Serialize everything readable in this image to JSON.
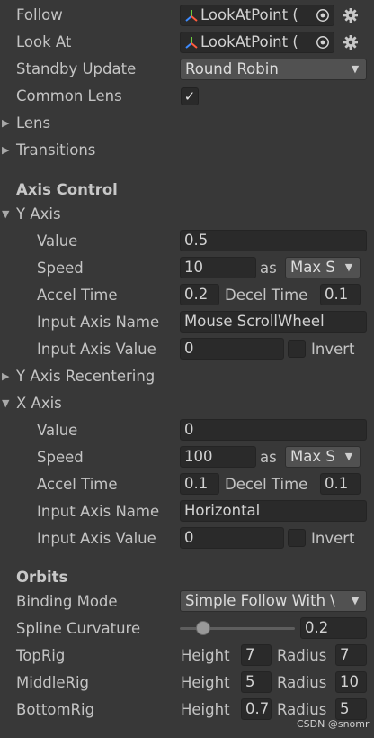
{
  "follow": {
    "label": "Follow",
    "value": "LookAtPoint ("
  },
  "look_at": {
    "label": "Look At",
    "value": "LookAtPoint ("
  },
  "standby_update": {
    "label": "Standby Update",
    "value": "Round Robin"
  },
  "common_lens": {
    "label": "Common Lens",
    "checked": true,
    "check_glyph": "✓"
  },
  "lens": {
    "label": "Lens",
    "expanded": false
  },
  "transitions": {
    "label": "Transitions",
    "expanded": false
  },
  "axis_control": {
    "heading": "Axis Control",
    "y_axis": {
      "label": "Y Axis",
      "expanded": true,
      "value_label": "Value",
      "value": "0.5",
      "speed_label": "Speed",
      "speed": "10",
      "as_label": "as",
      "speed_mode": "Max S",
      "accel_label": "Accel Time",
      "accel": "0.2",
      "decel_label": "Decel Time",
      "decel": "0.1",
      "input_name_label": "Input Axis Name",
      "input_name": "Mouse ScrollWheel",
      "input_value_label": "Input Axis Value",
      "input_value": "0",
      "invert_label": "Invert",
      "invert": false
    },
    "y_recentering": {
      "label": "Y Axis Recentering",
      "expanded": false
    },
    "x_axis": {
      "label": "X Axis",
      "expanded": true,
      "value_label": "Value",
      "value": "0",
      "speed_label": "Speed",
      "speed": "100",
      "as_label": "as",
      "speed_mode": "Max S",
      "accel_label": "Accel Time",
      "accel": "0.1",
      "decel_label": "Decel Time",
      "decel": "0.1",
      "input_name_label": "Input Axis Name",
      "input_name": "Horizontal",
      "input_value_label": "Input Axis Value",
      "input_value": "0",
      "invert_label": "Invert",
      "invert": false
    }
  },
  "orbits": {
    "heading": "Orbits",
    "binding_mode_label": "Binding Mode",
    "binding_mode": "Simple Follow With \\",
    "spline_label": "Spline Curvature",
    "spline_value": "0.2",
    "spline_fraction": 0.2,
    "height_label": "Height",
    "radius_label": "Radius",
    "rigs": [
      {
        "label": "TopRig",
        "height": "7",
        "radius": "7"
      },
      {
        "label": "MiddleRig",
        "height": "5",
        "radius": "10"
      },
      {
        "label": "BottomRig",
        "height": "0.7",
        "radius": "5"
      }
    ]
  },
  "watermark": "CSDN @snomr",
  "colors": {
    "background": "#383838",
    "field": "#2a2a2a",
    "dropdown": "#515151",
    "text": "#c4c4c4"
  },
  "icons": {
    "target": "target-icon",
    "settings": "gear-icon",
    "transform": "transform-axes-icon"
  }
}
